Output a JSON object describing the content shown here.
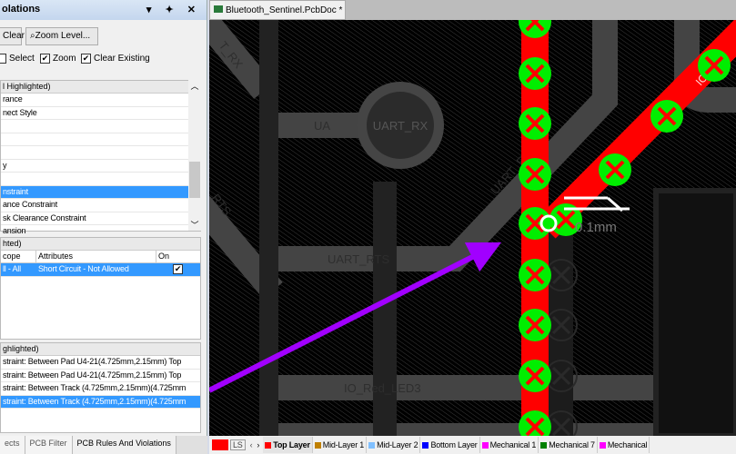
{
  "panel": {
    "title": "olations",
    "controls": "▾ ✦ ✕",
    "clear": "Clear",
    "zoom_level": "Zoom Level...",
    "checks": [
      {
        "label": "Select",
        "checked": false
      },
      {
        "label": "Zoom",
        "checked": true
      },
      {
        "label": "Clear Existing",
        "checked": true
      }
    ],
    "rules_header": "l Highlighted)",
    "rules": [
      "rance",
      "nect Style",
      "",
      "",
      "",
      "y",
      "",
      "nstraint",
      "ance Constraint",
      "sk Clearance Constraint",
      "ansion"
    ],
    "rules_selected": 7,
    "detail_header": "hted)",
    "detail_cols": [
      "cope",
      "Attributes",
      "On"
    ],
    "detail_row": {
      "scope": "ll - All",
      "attributes": "Short Circuit - Not Allowed",
      "on": true
    },
    "viol_header": "ghlighted)",
    "violations": [
      "straint: Between Pad U4-21(4.725mm,2.15mm)  Top",
      "straint: Between Pad U4-21(4.725mm,2.15mm)  Top",
      "straint: Between Track (4.725mm,2.15mm)(4.725mm",
      "straint: Between Track (4.725mm,2.15mm)(4.725mm"
    ],
    "viol_selected": 3,
    "tabs": [
      "ects",
      "PCB Filter",
      "PCB Rules And Violations"
    ],
    "active_tab": 2
  },
  "document": {
    "tab": "Bluetooth_Sentinel.PcbDoc *"
  },
  "pcb": {
    "labels": {
      "uart_rx_pad": "UART_RX",
      "ua": "UA",
      "uart_rts": "UART_RTS",
      "rts_diag": "UART_RTS",
      "io_red": "IO_Red_LED3",
      "io_red_diag": "IO_Red",
      "t_rx": "T_RX",
      "rts_left": "RTS",
      "measure": "0.1mm"
    },
    "colors": {
      "violation_track": "#ff0000",
      "violation_marker": "#00ee00",
      "arrow": "#a100ff"
    }
  },
  "layers": {
    "current": "LS",
    "items": [
      {
        "name": "Top Layer",
        "color": "#ff0000"
      },
      {
        "name": "Mid-Layer 1",
        "color": "#c08000"
      },
      {
        "name": "Mid-Layer 2",
        "color": "#80c0ff"
      },
      {
        "name": "Bottom Layer",
        "color": "#0000ff"
      },
      {
        "name": "Mechanical 1",
        "color": "#ff00ff"
      },
      {
        "name": "Mechanical 7",
        "color": "#008000"
      },
      {
        "name": "Mechanical",
        "color": "#ff00ff"
      }
    ]
  }
}
